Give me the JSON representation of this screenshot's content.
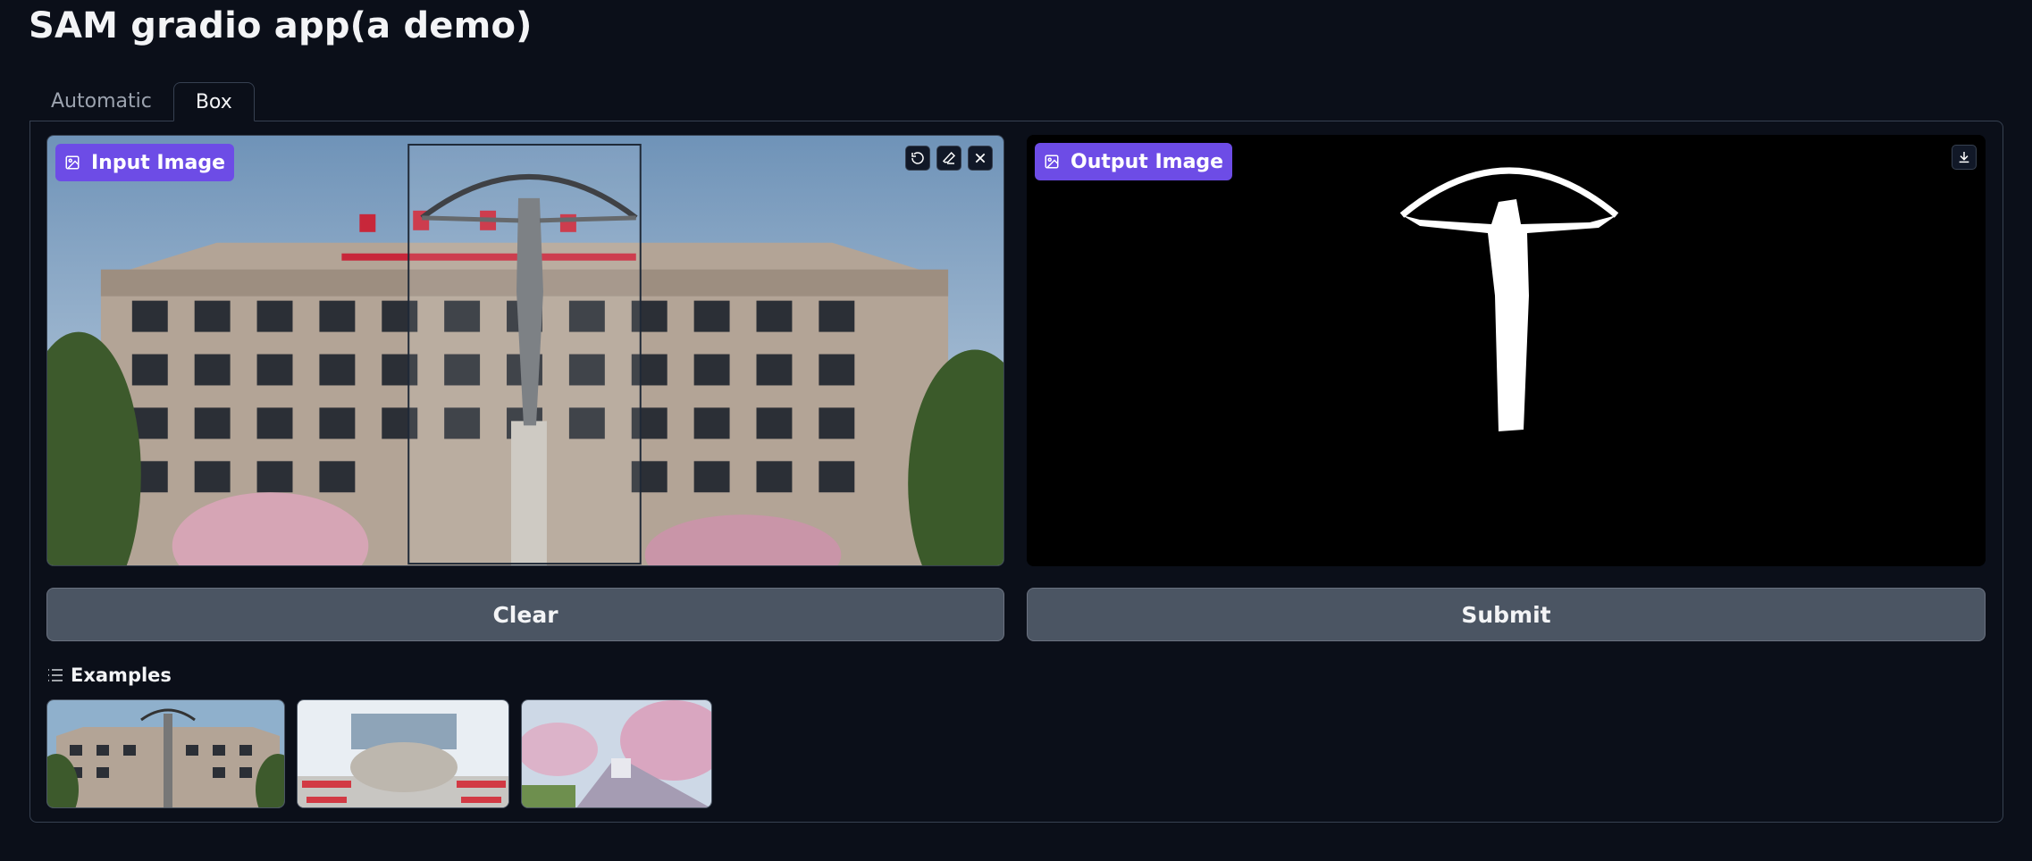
{
  "app": {
    "title": "SAM gradio app(a demo)"
  },
  "tabs": [
    {
      "label": "Automatic",
      "active": false
    },
    {
      "label": "Box",
      "active": true
    }
  ],
  "input_image": {
    "label": "Input Image",
    "tools": [
      "undo-icon",
      "eraser-icon",
      "close-icon"
    ]
  },
  "output_image": {
    "label": "Output Image",
    "tools": [
      "download-icon"
    ]
  },
  "buttons": {
    "clear": "Clear",
    "submit": "Submit"
  },
  "examples": {
    "heading": "Examples",
    "count": 3
  },
  "colors": {
    "background": "#0b0f19",
    "accent": "#6d4ce6",
    "button": "#4b5563"
  }
}
